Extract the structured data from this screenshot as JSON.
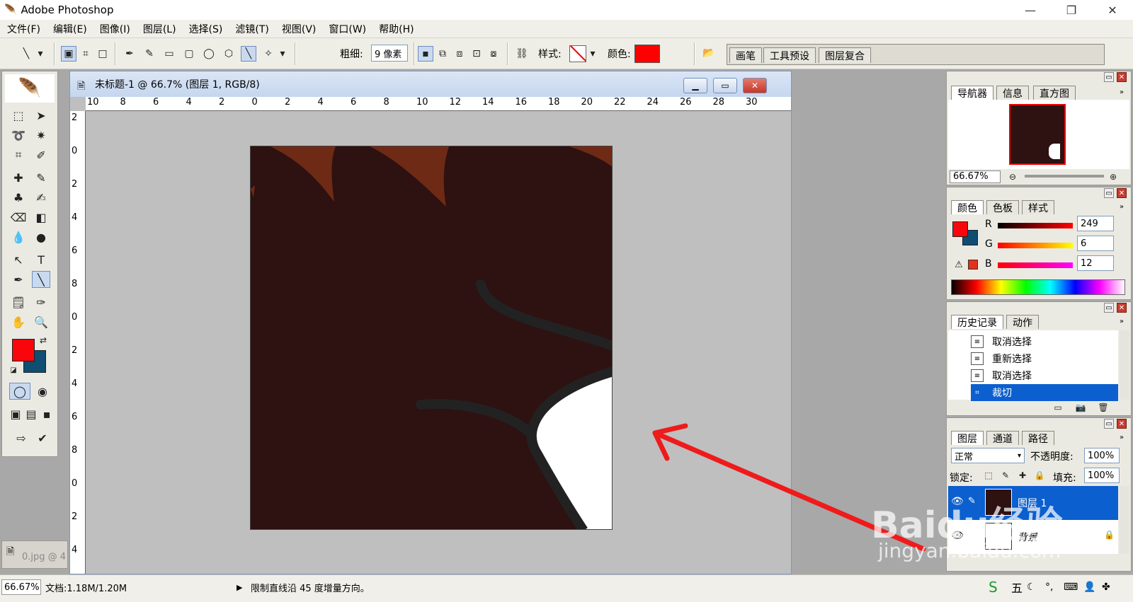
{
  "app": {
    "title": "Adobe Photoshop"
  },
  "menu": [
    "文件(F)",
    "编辑(E)",
    "图像(I)",
    "图层(L)",
    "选择(S)",
    "滤镜(T)",
    "视图(V)",
    "窗口(W)",
    "帮助(H)"
  ],
  "options": {
    "weight_label": "粗细:",
    "weight_value": "9 像素",
    "style_label": "样式:",
    "color_label": "颜色:",
    "color_value": "#ff0000",
    "well_tabs": [
      "画笔",
      "工具预设",
      "图层复合"
    ]
  },
  "document": {
    "title": "未标题-1 @ 66.7% (图层 1, RGB/8)",
    "h_ruler": [
      "10",
      "8",
      "6",
      "4",
      "2",
      "0",
      "2",
      "4",
      "6",
      "8",
      "10",
      "12",
      "14",
      "16",
      "18",
      "20",
      "22",
      "24",
      "26",
      "28",
      "30"
    ],
    "v_ruler": [
      "2",
      "0",
      "2",
      "4",
      "6",
      "8",
      "0",
      "2",
      "4",
      "6",
      "8",
      "0",
      "2",
      "4"
    ]
  },
  "minimized_doc": {
    "label": "0.jpg @ 4"
  },
  "navigator": {
    "tabs": [
      "导航器",
      "信息",
      "直方图"
    ],
    "zoom": "66.67%"
  },
  "color_panel": {
    "tabs": [
      "颜色",
      "色板",
      "样式"
    ],
    "channels": [
      {
        "label": "R",
        "value": "249"
      },
      {
        "label": "G",
        "value": "6"
      },
      {
        "label": "B",
        "value": "12"
      }
    ],
    "fg_color": "#f9060c",
    "bg_color": "#0f4d73"
  },
  "history": {
    "tabs": [
      "历史记录",
      "动作"
    ],
    "items": [
      "取消选择",
      "重新选择",
      "取消选择",
      "裁切"
    ]
  },
  "layers": {
    "tabs": [
      "图层",
      "通道",
      "路径"
    ],
    "blend_mode": "正常",
    "opacity_label": "不透明度:",
    "opacity_value": "100%",
    "lock_label": "锁定:",
    "fill_label": "填充:",
    "fill_value": "100%",
    "items": [
      {
        "name": "图层 1"
      },
      {
        "name": "背景"
      }
    ]
  },
  "status": {
    "zoom": "66.67%",
    "doc_size": "文档:1.18M/1.20M",
    "hint": "限制直线沿 45 度增量方向。"
  },
  "watermark": {
    "line1": "Baidu经验",
    "line2": "jingyan.baidu.com"
  },
  "taskbar_ime": [
    "五"
  ]
}
